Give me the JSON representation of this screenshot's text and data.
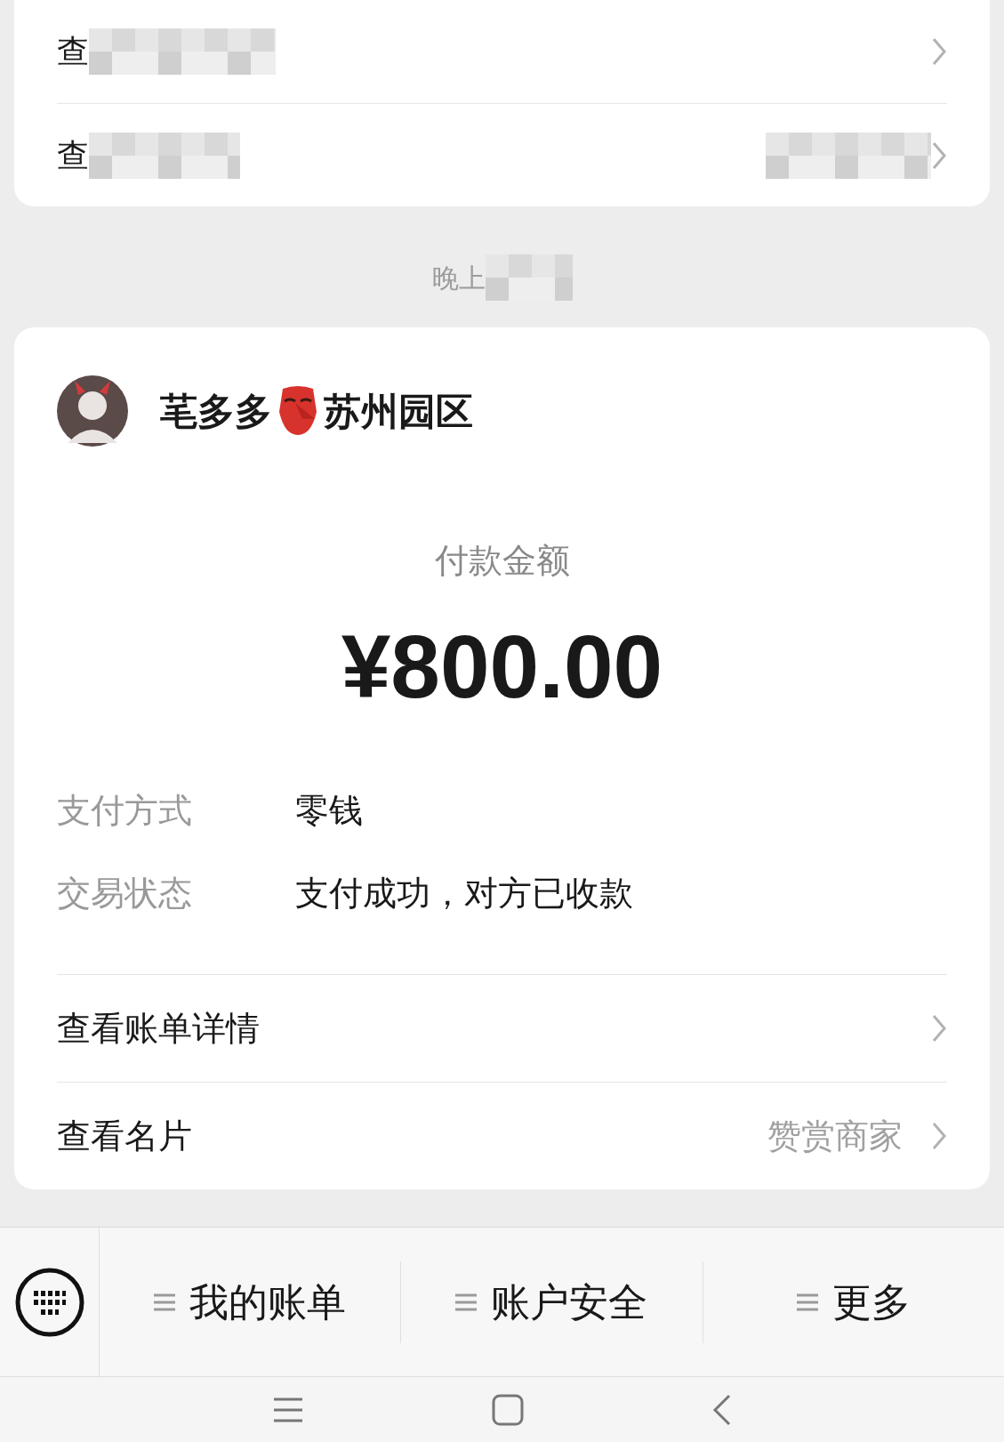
{
  "top_card": {
    "rows": [
      {
        "label": "查",
        "has_value": false
      },
      {
        "label": "查",
        "has_value": true
      }
    ]
  },
  "time_label": "晚上",
  "payment": {
    "name_before": "芼多多",
    "name_after": "苏州园区",
    "amount_label": "付款金额",
    "amount": "¥800.00",
    "details": [
      {
        "label": "支付方式",
        "value": "零钱"
      },
      {
        "label": "交易状态",
        "value": "支付成功，对方已收款"
      }
    ],
    "links": [
      {
        "label": "查看账单详情"
      },
      {
        "label": "查看名片",
        "value": "赞赏商家"
      }
    ]
  },
  "menu_bar": {
    "items": [
      "我的账单",
      "账户安全",
      "更多"
    ]
  }
}
